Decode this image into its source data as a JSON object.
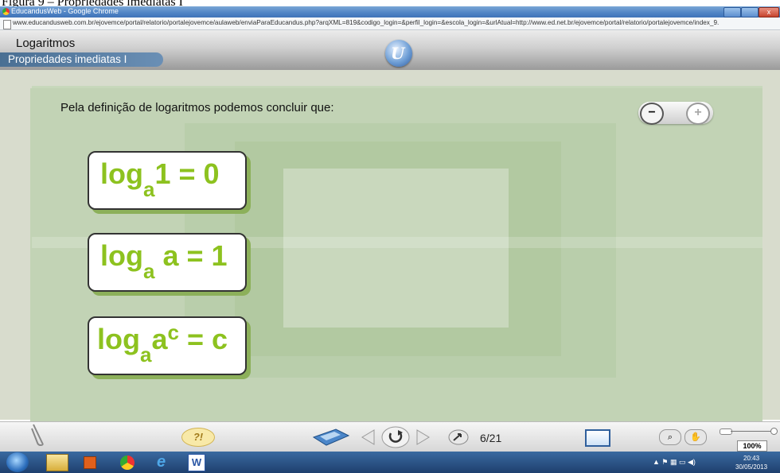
{
  "caption": "Figura 9 – Propriedades imediatas I",
  "window": {
    "title": "EducandusWeb - Google Chrome",
    "close_label": "x",
    "url": "www.educandusweb.com.br/ejovemce/portal/relatorio/portalejovemce/aulaweb/enviaParaEducandus.php?arqXML=819&codigo_login=&perfil_login=&escola_login=&urlAtual=http://www.ed.net.br/ejovemce/portal/relatorio/portalejovemce/index_9."
  },
  "app": {
    "title": "Logaritmos",
    "subtitle": "Propriedades imediatas I",
    "brand_letter": "U"
  },
  "lesson": {
    "intro": "Pela definição de logaritmos podemos concluir que:",
    "zoom_out_label": "−",
    "zoom_in_label": "+",
    "formulas": [
      {
        "log": "log",
        "base": "a",
        "arg": "1",
        "rhs": "= 0"
      },
      {
        "log": "log",
        "base": "a",
        "arg": "a",
        "rhs": "= 1"
      },
      {
        "log": "log",
        "base": "a",
        "arg": "a",
        "exp": "c",
        "rhs": "= c"
      }
    ]
  },
  "toolbar": {
    "help_label": "?!",
    "page": "6/21",
    "zoom_percent": "100%"
  },
  "taskbar": {
    "time": "20:43",
    "date": "30/05/2013"
  },
  "colors": {
    "formula_green": "#8dc21f",
    "card_shadow": "#8cb05a",
    "subtitle_bar": "#4a6f93"
  }
}
